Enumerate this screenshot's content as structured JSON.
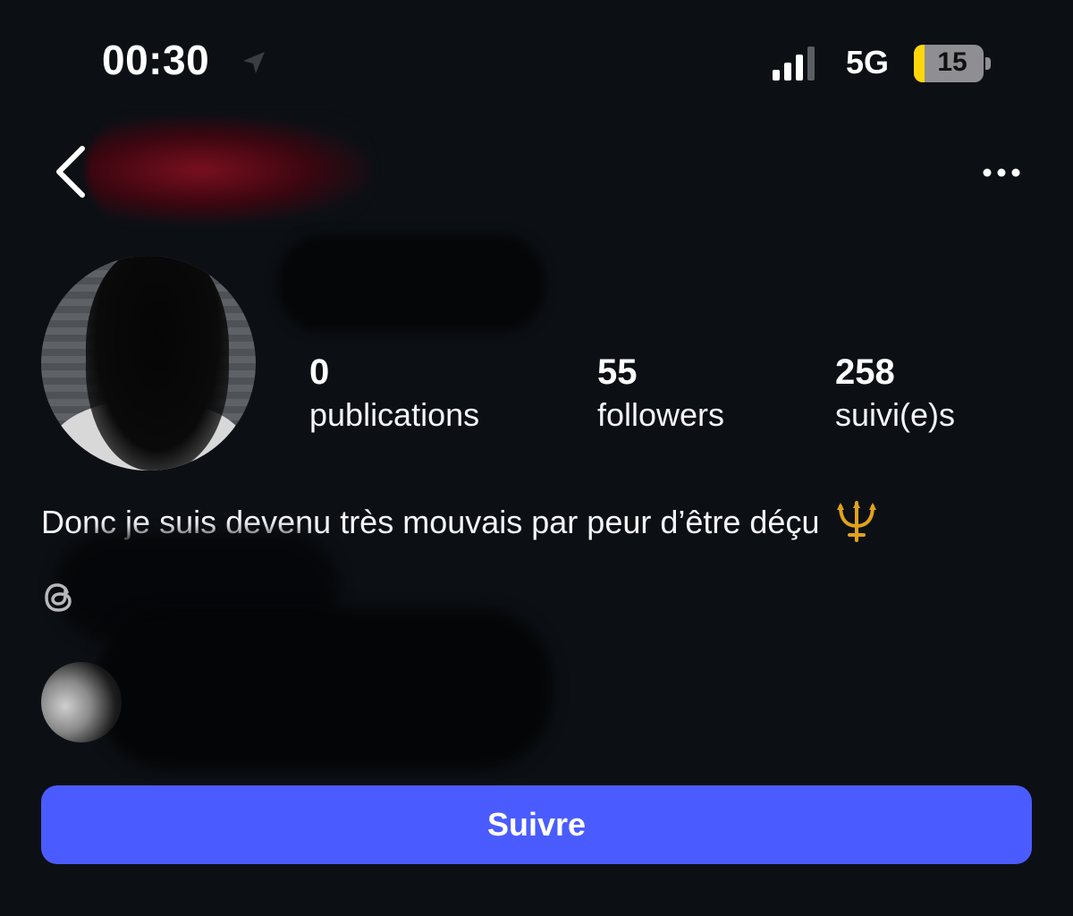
{
  "status_bar": {
    "time": "00:30",
    "network": "5G",
    "battery_level": "15",
    "icons": [
      "location-arrow-icon",
      "cellular-signal-icon",
      "battery-icon"
    ]
  },
  "header": {
    "back_icon": "chevron-left-icon",
    "more_icon": "more-horizontal-icon"
  },
  "profile": {
    "stats": [
      {
        "value": "0",
        "label": "publications"
      },
      {
        "value": "55",
        "label": "followers"
      },
      {
        "value": "258",
        "label": "suivi(e)s"
      }
    ],
    "bio": "Donc je suis devenu très mouvais par peur d’être déçu",
    "bio_emoji_icon": "trident-icon",
    "threads_icon": "threads-icon"
  },
  "actions": {
    "follow_label": "Suivre"
  },
  "colors": {
    "background": "#0c1015",
    "accent": "#4a5cff",
    "text": "#f5f5f7",
    "battery_low": "#ffd60a"
  }
}
